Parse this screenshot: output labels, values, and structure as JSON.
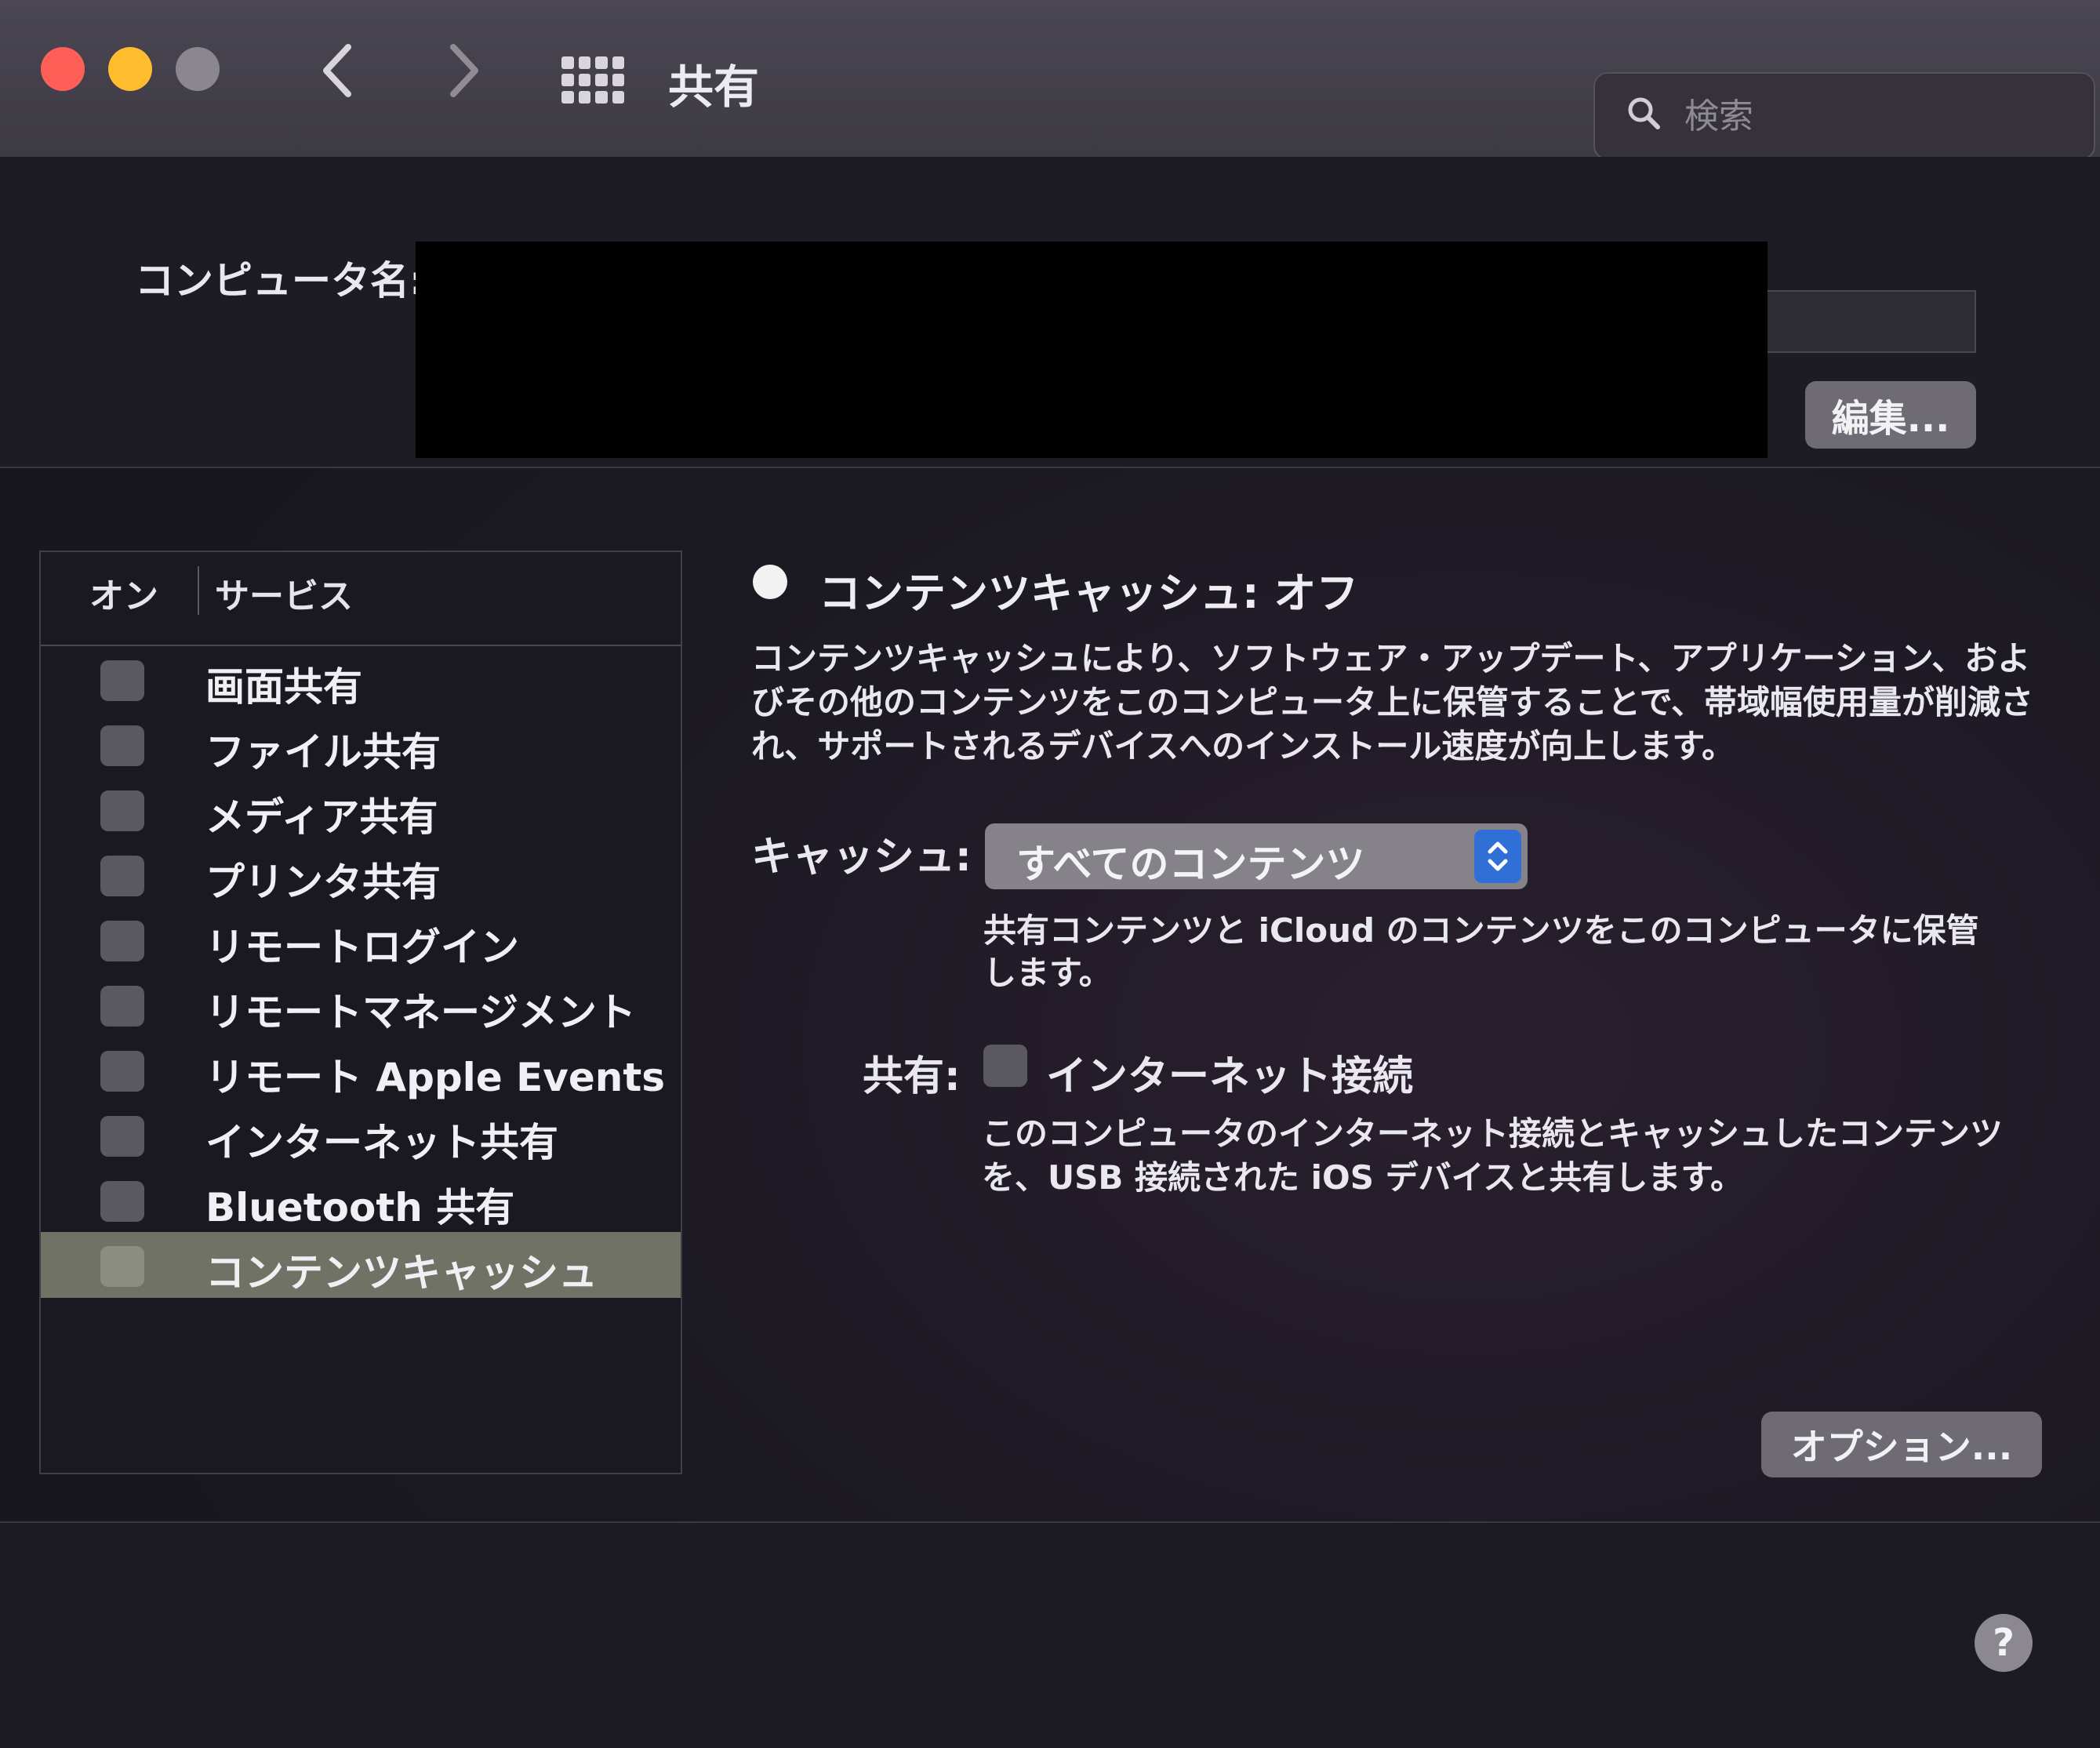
{
  "window": {
    "title": "共有",
    "nav_back": "‹",
    "nav_forward": "›"
  },
  "search": {
    "placeholder": "検索"
  },
  "computer_name": {
    "label": "コンピュータ名:",
    "edit_button": "編集..."
  },
  "service_list": {
    "header_on": "オン",
    "header_service": "サービス",
    "items": [
      {
        "label": "画面共有",
        "checked": false,
        "selected": false
      },
      {
        "label": "ファイル共有",
        "checked": false,
        "selected": false
      },
      {
        "label": "メディア共有",
        "checked": false,
        "selected": false
      },
      {
        "label": "プリンタ共有",
        "checked": false,
        "selected": false
      },
      {
        "label": "リモートログイン",
        "checked": false,
        "selected": false
      },
      {
        "label": "リモートマネージメント",
        "checked": false,
        "selected": false
      },
      {
        "label": "リモート Apple Events",
        "checked": false,
        "selected": false
      },
      {
        "label": "インターネット共有",
        "checked": false,
        "selected": false
      },
      {
        "label": "Bluetooth 共有",
        "checked": false,
        "selected": false
      },
      {
        "label": "コンテンツキャッシュ",
        "checked": false,
        "selected": true
      }
    ]
  },
  "detail": {
    "status": "コンテンツキャッシュ: オフ",
    "description": "コンテンツキャッシュにより、ソフトウェア・アップデート、アプリケーション、およびその他のコンテンツをこのコンピュータ上に保管することで、帯域幅使用量が削減され、サポートされるデバイスへのインストール速度が向上します。",
    "cache_label": "キャッシュ:",
    "cache_value": "すべてのコンテンツ",
    "cache_note": "共有コンテンツと iCloud のコンテンツをこのコンピュータに保管します。",
    "share_label": "共有:",
    "share_option": "インターネット接続",
    "share_checked": false,
    "share_note": "このコンピュータのインターネット接続とキャッシュしたコンテンツを、USB 接続された iOS デバイスと共有します。",
    "options_button": "オプション..."
  },
  "help_button": "?",
  "colors": {
    "close": "#fe5f57",
    "minimize": "#febc2e",
    "zoom_inactive": "#8a8790",
    "accent": "#2f6fd6",
    "selection": "#6f7265"
  },
  "icons": {
    "back": "chevron-left-icon",
    "forward": "chevron-right-icon",
    "show_all": "grid-icon",
    "search": "search-icon",
    "popup": "up-down-chevron-icon",
    "help": "question-icon"
  }
}
